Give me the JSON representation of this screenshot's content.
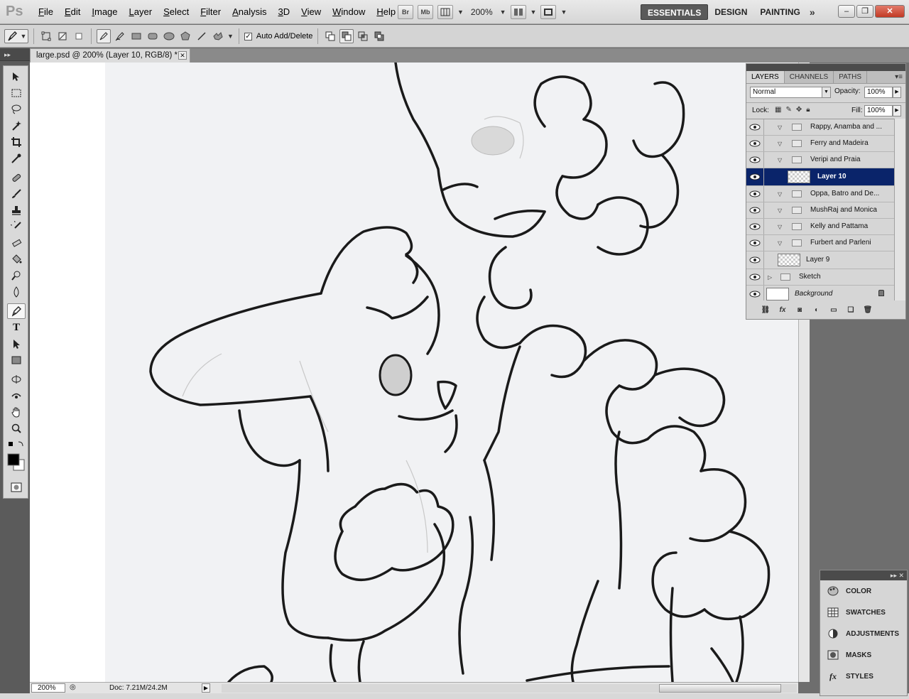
{
  "app": {
    "logo": "Ps"
  },
  "menu": [
    "File",
    "Edit",
    "Image",
    "Layer",
    "Select",
    "Filter",
    "Analysis",
    "3D",
    "View",
    "Window",
    "Help"
  ],
  "appbar": {
    "bridge": "Br",
    "minibridge": "Mb",
    "zoom": "200%"
  },
  "workspace": {
    "items": [
      "ESSENTIALS",
      "DESIGN",
      "PAINTING"
    ],
    "active": "ESSENTIALS",
    "more": "»"
  },
  "options": {
    "auto_add_delete_label": "Auto Add/Delete",
    "auto_add_delete_checked": true
  },
  "document": {
    "tab_title": "large.psd @ 200% (Layer 10, RGB/8) *",
    "zoom_field": "200%",
    "doc_size": "Doc: 7.21M/24.2M"
  },
  "layers_panel": {
    "tabs": [
      "LAYERS",
      "CHANNELS",
      "PATHS"
    ],
    "active_tab": "LAYERS",
    "blend_mode": "Normal",
    "opacity_label": "Opacity:",
    "opacity": "100%",
    "lock_label": "Lock:",
    "fill_label": "Fill:",
    "fill": "100%",
    "layers": [
      {
        "name": "Rappy, Anamba and ...",
        "kind": "group",
        "expanded": true,
        "indent": 1
      },
      {
        "name": "Ferry and Madeira",
        "kind": "group",
        "expanded": true,
        "indent": 1
      },
      {
        "name": "Veripi and Praia",
        "kind": "group",
        "expanded": true,
        "indent": 1
      },
      {
        "name": "Layer 10",
        "kind": "layer",
        "selected": true,
        "indent": 2
      },
      {
        "name": "Oppa, Batro and De...",
        "kind": "group",
        "expanded": true,
        "indent": 1
      },
      {
        "name": "MushRaj and Monica",
        "kind": "group",
        "expanded": true,
        "indent": 1
      },
      {
        "name": "Kelly and Pattama",
        "kind": "group",
        "expanded": true,
        "indent": 1
      },
      {
        "name": "Furbert and Parleni",
        "kind": "group",
        "expanded": true,
        "indent": 1
      },
      {
        "name": "Layer 9",
        "kind": "layer",
        "indent": 0
      },
      {
        "name": "Sketch",
        "kind": "group",
        "expanded": false,
        "indent": 0
      },
      {
        "name": "Background",
        "kind": "background",
        "locked": true,
        "indent": 0
      }
    ]
  },
  "mini_panels": [
    "COLOR",
    "SWATCHES",
    "ADJUSTMENTS",
    "MASKS",
    "STYLES"
  ],
  "colors": {
    "selection": "#0a246a",
    "active_workspace": "#5a5a5a",
    "panel": "#d6d6d6"
  }
}
